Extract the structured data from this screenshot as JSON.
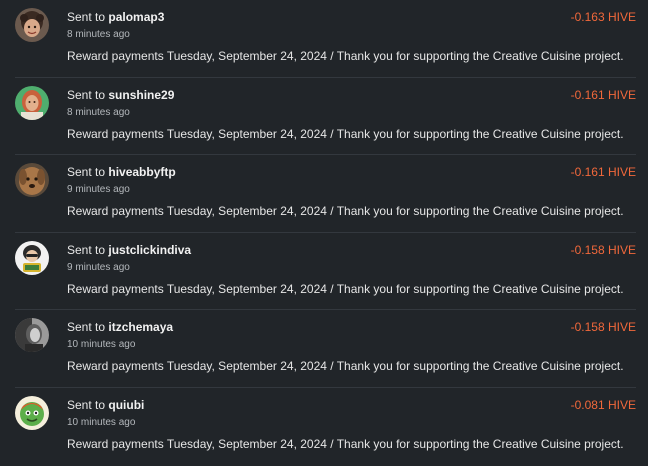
{
  "transactions": [
    {
      "sent_prefix": "Sent to",
      "username": "palomap3",
      "time": "8 minutes ago",
      "amount": "-0.163 HIVE",
      "memo": "Reward payments Tuesday, September 24, 2024 / Thank you for supporting the Creative Cuisine project.",
      "avatar_icon": "avatar-curly-hair-person"
    },
    {
      "sent_prefix": "Sent to",
      "username": "sunshine29",
      "time": "8 minutes ago",
      "amount": "-0.161 HIVE",
      "memo": "Reward payments Tuesday, September 24, 2024 / Thank you for supporting the Creative Cuisine project.",
      "avatar_icon": "avatar-woman-green-background"
    },
    {
      "sent_prefix": "Sent to",
      "username": "hiveabbyftp",
      "time": "9 minutes ago",
      "amount": "-0.161 HIVE",
      "memo": "Reward payments Tuesday, September 24, 2024 / Thank you for supporting the Creative Cuisine project.",
      "avatar_icon": "avatar-brown-dog"
    },
    {
      "sent_prefix": "Sent to",
      "username": "justclickindiva",
      "time": "9 minutes ago",
      "amount": "-0.158 HIVE",
      "memo": "Reward payments Tuesday, September 24, 2024 / Thank you for supporting the Creative Cuisine project.",
      "avatar_icon": "avatar-cartoon-hello"
    },
    {
      "sent_prefix": "Sent to",
      "username": "itzchemaya",
      "time": "10 minutes ago",
      "amount": "-0.158 HIVE",
      "memo": "Reward payments Tuesday, September 24, 2024 / Thank you for supporting the Creative Cuisine project.",
      "avatar_icon": "avatar-grayscale-portrait"
    },
    {
      "sent_prefix": "Sent to",
      "username": "quiubi",
      "time": "10 minutes ago",
      "amount": "-0.081 HIVE",
      "memo": "Reward payments Tuesday, September 24, 2024 / Thank you for supporting the Creative Cuisine project.",
      "avatar_icon": "avatar-cartoon-green-face"
    }
  ],
  "colors": {
    "background": "#212529",
    "amount_negative": "#f1683b",
    "divider": "#33383e",
    "text": "#e6e6e6",
    "muted": "#b4b8bc"
  }
}
